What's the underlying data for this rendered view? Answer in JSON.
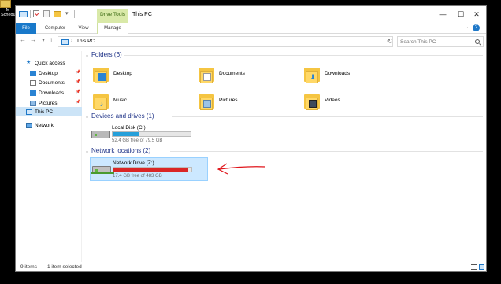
{
  "desktop": {
    "icon_label": "M\nSchedul"
  },
  "window": {
    "title": "This PC",
    "context_tab_group": "Drive Tools",
    "controls": {
      "minimize": "—",
      "maximize": "☐",
      "close": "✕"
    }
  },
  "ribbon": {
    "tabs": [
      "File",
      "Computer",
      "View",
      "Manage"
    ],
    "collapse": "⌄",
    "help": "?"
  },
  "address": {
    "path": "This PC",
    "separator": "›",
    "search_placeholder": "Search This PC"
  },
  "nav": {
    "quick_access": "Quick access",
    "items": [
      "Desktop",
      "Documents",
      "Downloads",
      "Pictures"
    ],
    "this_pc": "This PC",
    "network": "Network"
  },
  "content": {
    "folders_header": "Folders (6)",
    "folders": [
      "Desktop",
      "Documents",
      "Downloads",
      "Music",
      "Pictures",
      "Videos"
    ],
    "drives_header": "Devices and drives (1)",
    "local_disk": {
      "name": "Local Disk (C:)",
      "free": "52.4 GB free of 79.5 GB",
      "used_fraction": 0.34,
      "color": "#26a0da"
    },
    "network_header": "Network locations (2)",
    "network_drive": {
      "name": "Network Drive (Z:)",
      "free": "17.4 GB free of 483 GB",
      "used_fraction": 0.96,
      "color": "#da2626"
    }
  },
  "status": {
    "count": "9 items",
    "selected": "1 item selected"
  },
  "annotation": {
    "arrow_color": "#e0151b"
  }
}
